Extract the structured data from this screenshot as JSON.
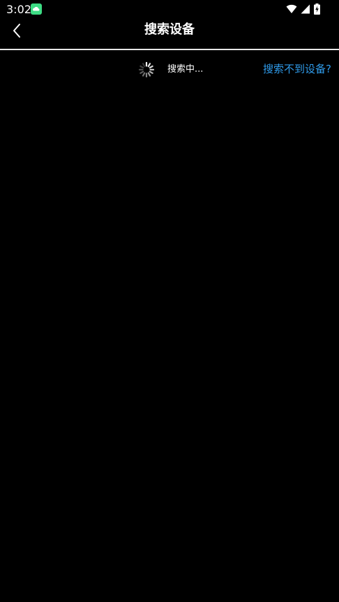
{
  "status_bar": {
    "time": "3:02",
    "app_icon": "cloud-notification-icon",
    "icons": [
      "wifi-icon",
      "cellular-signal-icon",
      "battery-charging-icon"
    ]
  },
  "app_bar": {
    "back_icon": "back-arrow-icon",
    "title": "搜索设备"
  },
  "search": {
    "spinner_icon": "loading-spinner-icon",
    "status_text": "搜索中...",
    "not_found_link": "搜索不到设备?"
  },
  "colors": {
    "background": "#000000",
    "text": "#ffffff",
    "link": "#2f9bea",
    "divider": "#e8e8e8",
    "app_icon_green": "#3ddc84"
  }
}
